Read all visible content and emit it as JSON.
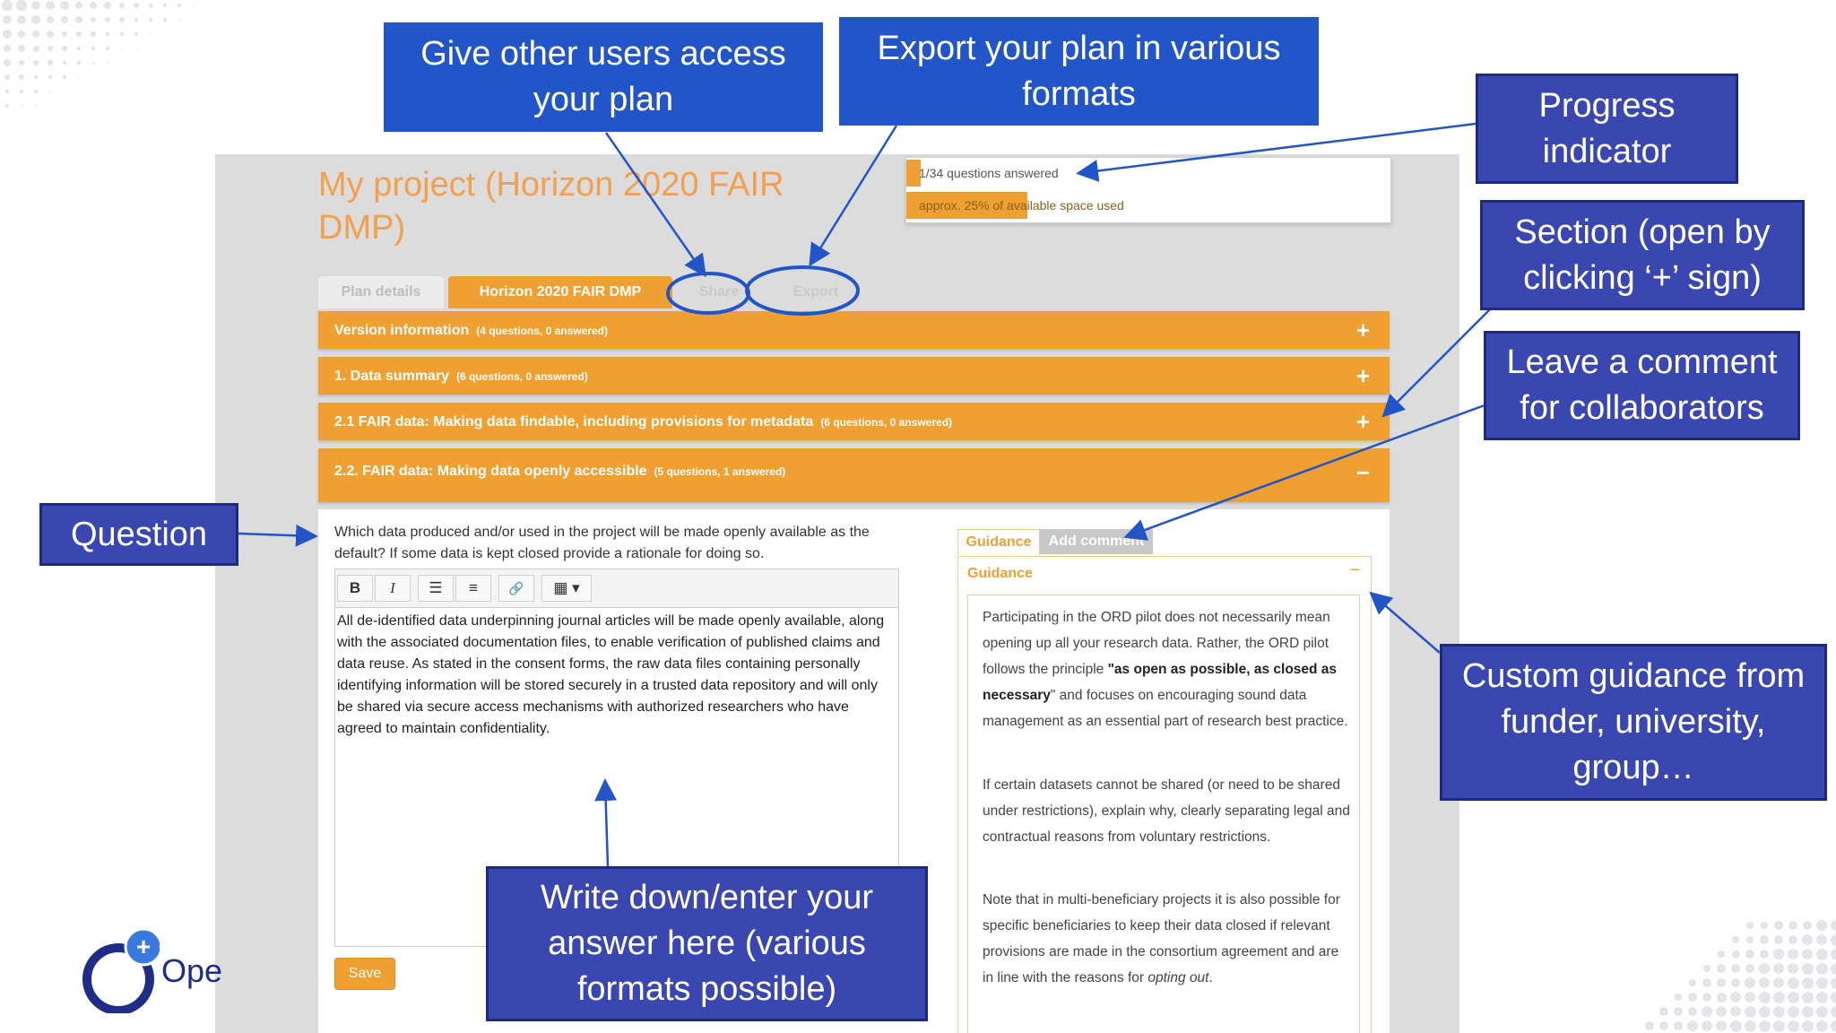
{
  "app": {
    "project_title": "My project (Horizon 2020 FAIR DMP)",
    "progress": {
      "answered_text": "1/34 questions answered",
      "answered_fraction": 0.0294,
      "space_text": "approx. 25% of available space used",
      "space_fraction": 0.25
    },
    "tabs": [
      {
        "label": "Plan details",
        "state": "inactive"
      },
      {
        "label": "Horizon 2020 FAIR DMP",
        "state": "active"
      },
      {
        "label": "Share",
        "state": "plain"
      },
      {
        "label": "Export",
        "state": "plain"
      }
    ],
    "sections": [
      {
        "title": "Version information",
        "sub": "(4 questions, 0 answered)",
        "toggle": "+"
      },
      {
        "title": "1. Data summary",
        "sub": "(6 questions, 0 answered)",
        "toggle": "+"
      },
      {
        "title": "2.1 FAIR data: Making data findable, including provisions for metadata",
        "sub": "(6 questions, 0 answered)",
        "toggle": "+"
      },
      {
        "title": "2.2. FAIR data: Making data openly accessible",
        "sub": "(5 questions, 1 answered)",
        "toggle": "−"
      }
    ],
    "question": "Which data produced and/or used in the project will be made openly available as the default? If some data is kept closed provide a rationale for doing so.",
    "toolbar": {
      "bold": "B",
      "italic": "I",
      "bullets": "☰",
      "numbers": "≡",
      "link": "🔗",
      "table": "▦ ▾"
    },
    "answer": "All de-identified data underpinning journal articles will be made openly available, along with the associated documentation files, to enable verification of published claims and data reuse. As stated in the consent forms, the raw data files containing personally identifying information will be stored securely in a trusted data repository and will only be shared via secure access mechanisms with authorized researchers who have agreed to maintain confidentiality.",
    "save_label": "Save",
    "guidance_tabs": {
      "guidance": "Guidance",
      "comment": "Add comment"
    },
    "guidance": {
      "header": "Guidance",
      "toggle": "−",
      "p1_before": "Participating in the ORD pilot does not necessarily mean opening up all your research data. Rather, the ORD pilot follows the principle ",
      "p1_bold": "\"as open as possible, as closed as necessary",
      "p1_after": "\" and focuses on encouraging sound data management as an essential part of research best practice.",
      "p2": "If certain datasets cannot be shared (or need to be shared under restrictions), explain why, clearly separating legal and contractual reasons from voluntary restrictions.",
      "p3_before": "Note that in multi-beneficiary projects it is also possible for specific beneficiaries to keep their data closed if relevant provisions are made in the consortium agreement and are in line with the reasons for ",
      "p3_italic": "opting out",
      "p3_after": "."
    }
  },
  "callouts": {
    "share": "Give other users access your plan",
    "export": "Export your plan in various formats",
    "progress": "Progress indicator",
    "section": "Section (open by clicking ‘+’ sign)",
    "comment": "Leave a comment for collaborators",
    "question": "Question",
    "answer": "Write down/enter your answer here (various formats possible)",
    "guidance": "Custom guidance from funder, university, group…"
  },
  "logo": {
    "text": "Ope",
    "plus": "+"
  },
  "colors": {
    "orange": "#f0a030",
    "callout_blue": "#2255c8",
    "callout_dark": "#3b47b0",
    "logo_blue": "#1f2d87",
    "plus_blue": "#3a7ae0"
  }
}
